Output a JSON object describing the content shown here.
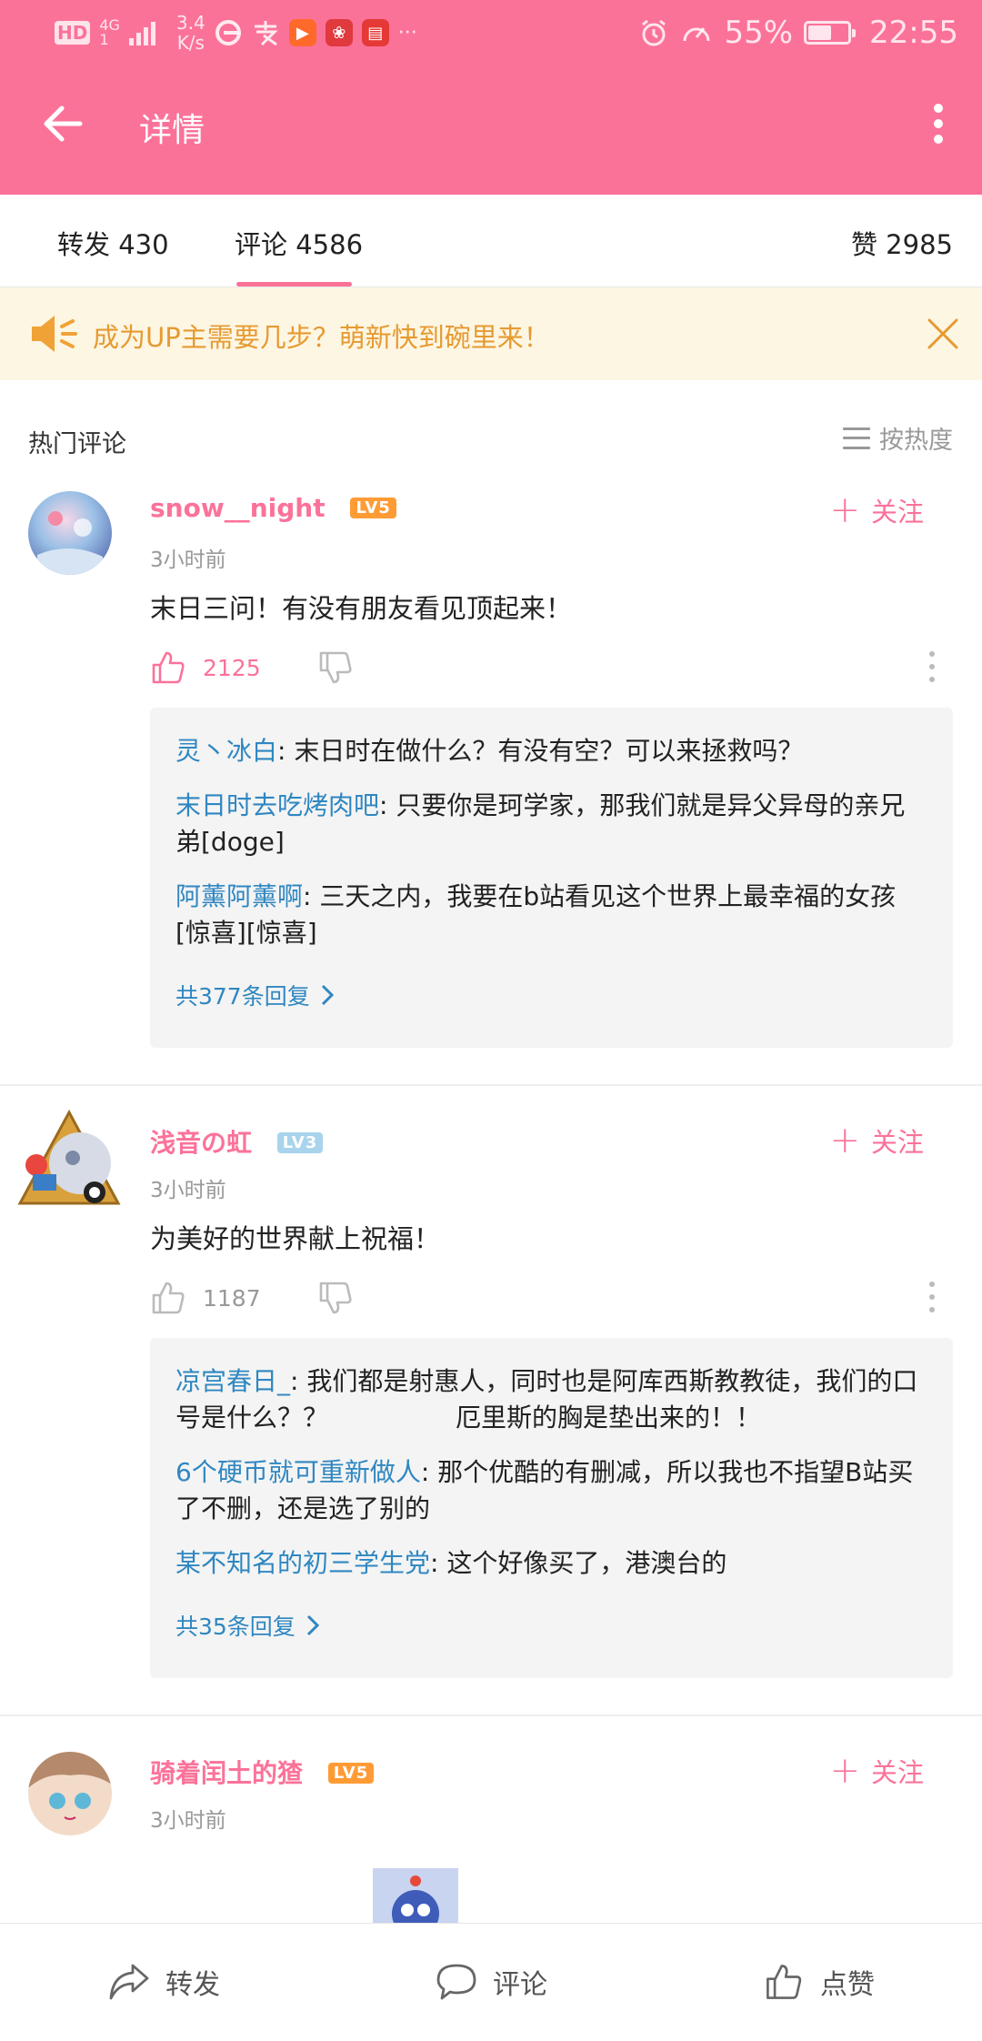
{
  "status_bar": {
    "hd": "HD",
    "network": "4G",
    "network_sub": "1",
    "speed_value": "3.4",
    "speed_unit": "K/s",
    "dots": "···",
    "battery": "55%",
    "time": "22:55"
  },
  "appbar": {
    "title": "详情"
  },
  "tabs": {
    "repost": "转发 430",
    "comment": "评论 4586",
    "like": "赞 2985"
  },
  "banner": {
    "text": "成为UP主需要几步？萌新快到碗里来！"
  },
  "section": {
    "title": "热门评论",
    "sort_label": "按热度"
  },
  "comments": [
    {
      "user": "snow__night",
      "level": "LV5",
      "follow": "关注",
      "time": "3小时前",
      "text": "末日三问！有没有朋友看见顶起来！",
      "likes": "2125",
      "replies": [
        {
          "name": "灵丶冰白",
          "text": ": 末日时在做什么？有没有空？可以来拯救吗？"
        },
        {
          "name": "末日时去吃烤肉吧",
          "text": ": 只要你是珂学家，那我们就是异父异母的亲兄弟[doge]"
        },
        {
          "name": "阿薰阿薰啊",
          "text": ": 三天之内，我要在b站看见这个世界上最幸福的女孩[惊喜][惊喜]"
        }
      ],
      "more_replies": "共377条回复"
    },
    {
      "user": "浅音の虹",
      "level": "LV3",
      "follow": "关注",
      "time": "3小时前",
      "text": "为美好的世界献上祝福！",
      "likes": "1187",
      "replies": [
        {
          "name": "凉宫春日_",
          "text": ": 我们都是射惠人，同时也是阿库西斯教教徒，我们的口号是什么？？　　　　　厄里斯的胸是垫出来的！！"
        },
        {
          "name": "6个硬币就可重新做人",
          "text": ": 那个优酷的有删减，所以我也不指望B站买了不删，还是选了别的"
        },
        {
          "name": "某不知名的初三学生党",
          "text": ": 这个好像买了，港澳台的"
        }
      ],
      "more_replies": "共35条回复"
    },
    {
      "user": "骑着闰土的猹",
      "level": "LV5",
      "follow": "关注",
      "time": "3小时前"
    }
  ],
  "bottom_bar": {
    "repost": "转发",
    "comment": "评论",
    "like": "点赞"
  },
  "colors": {
    "brand_pink": "#fb7299",
    "link_blue": "#2f87c1",
    "banner_orange": "#e69a31",
    "level5": "#ff9b35",
    "level3": "#a9d4ec"
  }
}
